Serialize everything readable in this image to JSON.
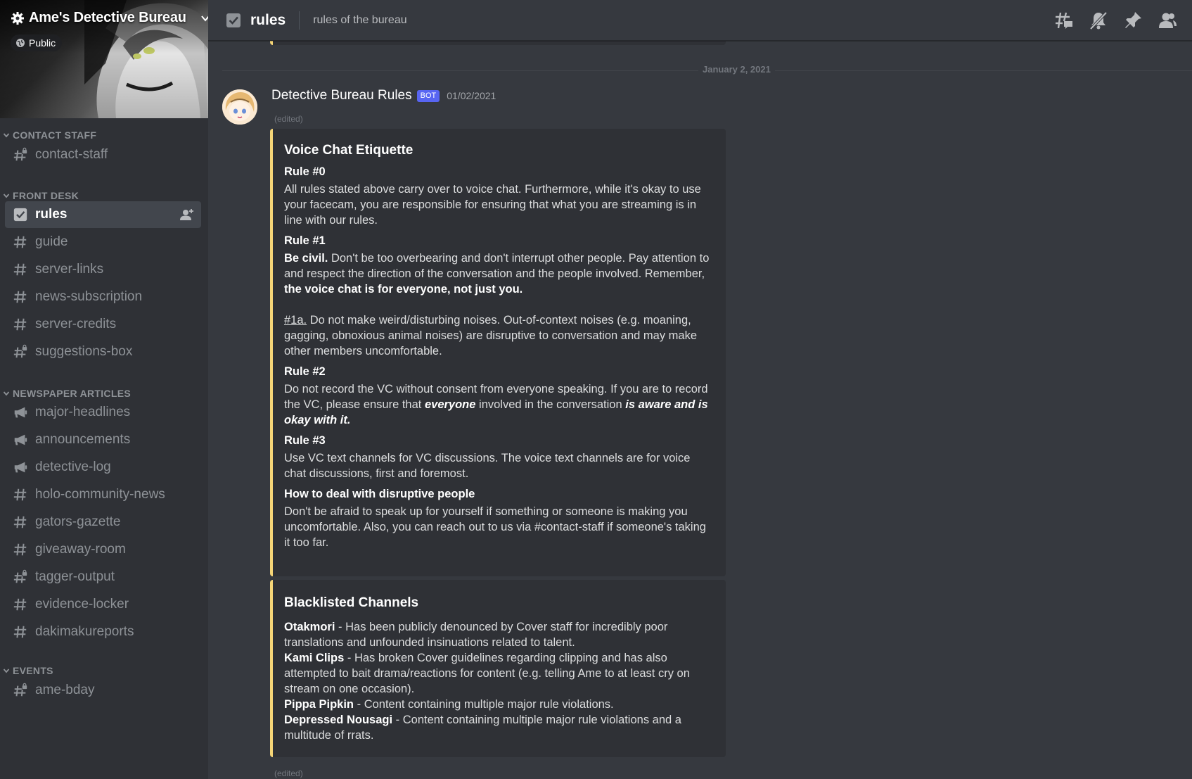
{
  "server": {
    "name": "Ame's Detective Bureau",
    "badge": "Public"
  },
  "sidebar": {
    "categories": [
      {
        "label": "CONTACT STAFF",
        "channels": [
          {
            "label": "contact-staff",
            "icon": "hash-lock-icon"
          }
        ]
      },
      {
        "label": "FRONT DESK",
        "channels": [
          {
            "label": "rules",
            "icon": "rules-check-icon",
            "active": true
          },
          {
            "label": "guide",
            "icon": "hash-icon"
          },
          {
            "label": "server-links",
            "icon": "hash-icon"
          },
          {
            "label": "news-subscription",
            "icon": "hash-icon"
          },
          {
            "label": "server-credits",
            "icon": "hash-icon"
          },
          {
            "label": "suggestions-box",
            "icon": "hash-lock-icon"
          }
        ]
      },
      {
        "label": "NEWSPAPER ARTICLES",
        "channels": [
          {
            "label": "major-headlines",
            "icon": "megaphone-icon"
          },
          {
            "label": "announcements",
            "icon": "megaphone-icon"
          },
          {
            "label": "detective-log",
            "icon": "megaphone-icon"
          },
          {
            "label": "holo-community-news",
            "icon": "hash-icon"
          },
          {
            "label": "gators-gazette",
            "icon": "hash-icon"
          },
          {
            "label": "giveaway-room",
            "icon": "hash-icon"
          },
          {
            "label": "tagger-output",
            "icon": "hash-lock-icon"
          },
          {
            "label": "evidence-locker",
            "icon": "hash-icon"
          },
          {
            "label": "dakimakureports",
            "icon": "hash-icon"
          }
        ]
      },
      {
        "label": "EVENTS",
        "channels": [
          {
            "label": "ame-bday",
            "icon": "hash-lock-icon"
          }
        ]
      }
    ]
  },
  "header": {
    "channel": "rules",
    "topic": "rules of the bureau",
    "actions": [
      "threads-icon",
      "mute-icon",
      "pin-icon",
      "members-icon"
    ]
  },
  "messages": {
    "date_divider": "January 2, 2021",
    "author": "Detective Bureau Rules",
    "bot_tag": "BOT",
    "timestamp": "01/02/2021",
    "edited": "(edited)",
    "edited_bottom": "(edited)"
  },
  "embed1": {
    "title": "Voice Chat Etiquette",
    "rule0": {
      "name": "Rule #0",
      "text": "All rules stated above carry over to voice chat. Furthermore, while it's okay to use your facecam, you are responsible for ensuring that what you are streaming is in line with our rules."
    },
    "rule1": {
      "name": "Rule #1",
      "lead": "Be civil.",
      "text": " Don't be too overbearing and don't interrupt other people. Pay attention to and respect the direction of the conversation and the people involved. Remember, ",
      "emph": "the voice chat is for everyone, not just you.",
      "sub_ref": "#1a.",
      "sub_text": " Do not make weird/disturbing noises. Out-of-context noises (e.g. moaning, gagging, obnoxious animal noises) are disruptive to conversation and may make other members uncomfortable."
    },
    "rule2": {
      "name": "Rule #2",
      "text_a": "Do not record the VC without consent from everyone speaking. If you are to record the VC, please ensure that ",
      "emph_a": "everyone",
      "text_b": " involved in the conversation ",
      "emph_b": "is aware and is okay with it."
    },
    "rule3": {
      "name": "Rule #3",
      "text": "Use VC text channels for VC discussions. The voice text channels are for voice chat discussions, first and foremost."
    },
    "disruptive": {
      "name": "How to deal with disruptive people",
      "text": "Don't be afraid to speak up for yourself if something or someone is making you uncomfortable. Also, you can reach out to us via #contact-staff if someone's taking it too far."
    }
  },
  "embed2": {
    "title": "Blacklisted Channels",
    "entries": [
      {
        "name": "Otakmori",
        "text": " - Has been publicly denounced by Cover staff for incredibly poor translations and unfounded insinuations related to talent."
      },
      {
        "name": "Kami Clips",
        "text": " - Has broken Cover guidelines regarding clipping and has also attempted to bait drama/reactions for content (e.g. telling Ame to at least cry on stream on one occasion)."
      },
      {
        "name": "Pippa Pipkin",
        "text": " - Content containing multiple major rule violations."
      },
      {
        "name": "Depressed Nousagi",
        "text": " - Content containing multiple major rule violations and a multitude of rrats."
      }
    ]
  },
  "colors": {
    "embed_accent": "#f5d577",
    "bot_tag": "#5865f2",
    "sidebar_bg": "#2f3136",
    "main_bg": "#36393f"
  }
}
